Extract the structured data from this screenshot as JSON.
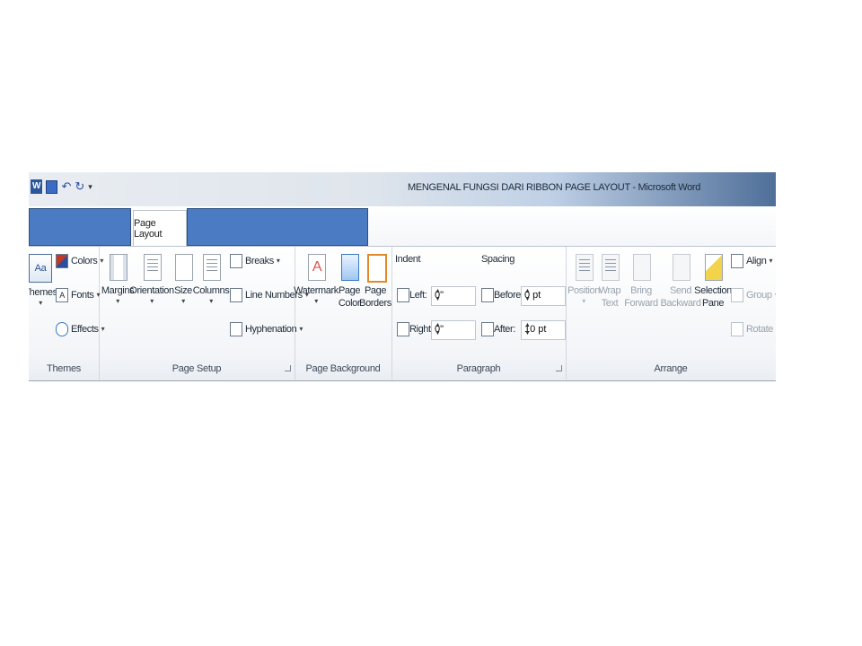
{
  "window": {
    "title": "MENGENAL FUNGSI DARI RIBBON PAGE LAYOUT - Microsoft Word"
  },
  "quick_access": {
    "word_icon": "W",
    "save_icon": "save-icon",
    "undo": "↶",
    "redo": "↻"
  },
  "tabs": {
    "active": "Page Layout"
  },
  "colors": {
    "redaction": "#4b7bc2",
    "title_gradient_end": "#4f6f99"
  },
  "ribbon": {
    "themes": {
      "group_label": "Themes",
      "themes_btn": "Themes",
      "colors": "Colors",
      "fonts": "Fonts",
      "effects": "Effects"
    },
    "page_setup": {
      "group_label": "Page Setup",
      "margins": "Margins",
      "orientation": "Orientation",
      "size": "Size",
      "columns": "Columns",
      "breaks": "Breaks",
      "line_numbers": "Line Numbers",
      "hyphenation": "Hyphenation"
    },
    "page_background": {
      "group_label": "Page Background",
      "watermark": "Watermark",
      "page_color_1": "Page",
      "page_color_2": "Color",
      "page_borders_1": "Page",
      "page_borders_2": "Borders"
    },
    "paragraph": {
      "group_label": "Paragraph",
      "indent_header": "Indent",
      "spacing_header": "Spacing",
      "left_label": "Left:",
      "left_value": "0\"",
      "right_label": "Right:",
      "right_value": "0\"",
      "before_label": "Before:",
      "before_value": "0 pt",
      "after_label": "After:",
      "after_value": "10 pt"
    },
    "arrange": {
      "group_label": "Arrange",
      "position": "Position",
      "wrap_1": "Wrap",
      "wrap_2": "Text",
      "bring_1": "Bring",
      "bring_2": "Forward",
      "send_1": "Send",
      "send_2": "Backward",
      "selection_1": "Selection",
      "selection_2": "Pane",
      "align": "Align",
      "group": "Group",
      "rotate": "Rotate"
    }
  }
}
